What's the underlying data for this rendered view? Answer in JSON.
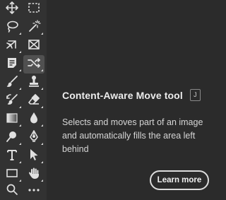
{
  "toolbar": {
    "tools": [
      {
        "row": 0,
        "col": 0,
        "icon": "move-icon"
      },
      {
        "row": 0,
        "col": 1,
        "icon": "rectangular-marquee-icon"
      },
      {
        "row": 1,
        "col": 0,
        "icon": "lasso-icon"
      },
      {
        "row": 1,
        "col": 1,
        "icon": "magic-wand-icon"
      },
      {
        "row": 2,
        "col": 0,
        "icon": "crop-icon"
      },
      {
        "row": 2,
        "col": 1,
        "icon": "frame-icon"
      },
      {
        "row": 3,
        "col": 0,
        "icon": "note-icon"
      },
      {
        "row": 3,
        "col": 1,
        "icon": "content-aware-move-icon",
        "active": true
      },
      {
        "row": 4,
        "col": 0,
        "icon": "brush-icon"
      },
      {
        "row": 4,
        "col": 1,
        "icon": "clone-stamp-icon"
      },
      {
        "row": 5,
        "col": 0,
        "icon": "history-brush-icon"
      },
      {
        "row": 5,
        "col": 1,
        "icon": "eraser-icon"
      },
      {
        "row": 6,
        "col": 0,
        "icon": "gradient-icon"
      },
      {
        "row": 6,
        "col": 1,
        "icon": "blur-drop-icon"
      },
      {
        "row": 7,
        "col": 0,
        "icon": "dodge-icon"
      },
      {
        "row": 7,
        "col": 1,
        "icon": "pen-icon"
      },
      {
        "row": 8,
        "col": 0,
        "icon": "type-icon"
      },
      {
        "row": 8,
        "col": 1,
        "icon": "path-selection-icon"
      },
      {
        "row": 9,
        "col": 0,
        "icon": "rectangle-shape-icon"
      },
      {
        "row": 9,
        "col": 1,
        "icon": "hand-icon"
      },
      {
        "row": 10,
        "col": 0,
        "icon": "zoom-icon"
      },
      {
        "row": 10,
        "col": 1,
        "icon": "more-tools-icon"
      }
    ]
  },
  "tooltip": {
    "title": "Content-Aware Move tool",
    "shortcut": "J",
    "description": "Selects and moves part of an image and automatically fills the area left behind",
    "learn_more_label": "Learn more"
  },
  "colors": {
    "toolbar_bg": "#323232",
    "panel_bg": "#2b2b2b",
    "active_tool_bg": "#505050",
    "icon": "#e0e0e0"
  }
}
